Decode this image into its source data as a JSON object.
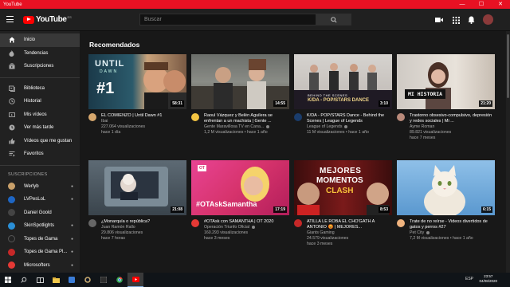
{
  "window": {
    "title": "YouTube",
    "controls": [
      "—",
      "☐",
      "✕"
    ]
  },
  "header": {
    "logo_word": "YouTube",
    "logo_country": "ES",
    "search_placeholder": "Buscar",
    "brand_color": "#ff0000"
  },
  "sidebar": {
    "main_items": [
      {
        "label": "Inicio",
        "icon": "home-icon",
        "active": true
      },
      {
        "label": "Tendencias",
        "icon": "trending-icon"
      },
      {
        "label": "Suscripciones",
        "icon": "subscriptions-icon"
      }
    ],
    "library_items": [
      {
        "label": "Biblioteca",
        "icon": "library-icon"
      },
      {
        "label": "Historial",
        "icon": "history-icon"
      },
      {
        "label": "Mis vídeos",
        "icon": "my-videos-icon"
      },
      {
        "label": "Ver más tarde",
        "icon": "watch-later-icon"
      },
      {
        "label": "Vídeos que me gustan",
        "icon": "liked-icon"
      },
      {
        "label": "Favoritos",
        "icon": "favorites-icon"
      }
    ],
    "subscriptions_header": "SUSCRIPCIONES",
    "subscriptions": [
      {
        "label": "Werlyb",
        "color": "#c9a06a"
      },
      {
        "label": "LVPesLoL",
        "color": "#1e66c4"
      },
      {
        "label": "Daniel Goold",
        "color": "#444444"
      },
      {
        "label": "SkinSpotlights",
        "color": "#2a8fd6"
      },
      {
        "label": "Topes de Gama",
        "color": "#222222"
      },
      {
        "label": "Topes de Gama Pl...",
        "color": "#c62828"
      },
      {
        "label": "Microsofters",
        "color": "#e53935"
      }
    ]
  },
  "main": {
    "section_title": "Recomendados",
    "videos": [
      {
        "title": "EL COMIENZO | Until Dawn #1",
        "channel": "Ibai",
        "views": "227.064 visualizaciones",
        "age": "hace 1 día",
        "duration": "58:31",
        "verified": true,
        "thumb": "t1",
        "avatar": "#d7a86e"
      },
      {
        "title": "Raoul Vázquez y Belén Aguilera se enfrentan a un machista | Gente ...",
        "channel": "Gente Maravillosa TV en Cana...",
        "views": "1,2 M visualizaciones",
        "age": "hace 1 año",
        "duration": "14:55",
        "verified": true,
        "thumb": "t2",
        "avatar": "#f4c542"
      },
      {
        "title": "K/DA - POP/STARS Dance - Behind the Scenes | League of Legends",
        "channel": "League of Legends",
        "views": "11 M visualizaciones",
        "age": "hace 1 año",
        "duration": "3:10",
        "verified": true,
        "thumb": "t3",
        "avatar": "#1a3c6b"
      },
      {
        "title": "Trastorno obsesivo-compulsivo, depresión y redes sociales | Mi ...",
        "channel": "Ayme Roman",
        "views": "89.821 visualizaciones",
        "age": "hace 7 meses",
        "duration": "21:20",
        "verified": false,
        "thumb": "t4",
        "avatar": "#b98a7a",
        "thumb_text": "MI HISTORIA"
      },
      {
        "title": "¿Monarquía o república?",
        "channel": "Juan Ramón Rallo",
        "views": "29.806 visualizaciones",
        "age": "hace 7 horas",
        "duration": "21:08",
        "verified": false,
        "thumb": "t5",
        "avatar": "#666666"
      },
      {
        "title": "#OTAsk con SAMANTHA | OT 2020",
        "channel": "Operación Triunfo Oficial",
        "views": "160.293 visualizaciones",
        "age": "hace 3 meses",
        "duration": "17:19",
        "verified": true,
        "thumb": "t6",
        "avatar": "#e53935",
        "thumb_text": "#OTAskSamantha"
      },
      {
        "title": "ATILLA LE ROBA EL CHO'GATH A ANTONIO 😡 | MEJORES...",
        "channel": "Giants Gaming",
        "views": "24.579 visualizaciones",
        "age": "hace 3 meses",
        "duration": "8:53",
        "verified": false,
        "thumb": "t7",
        "avatar": "#c62828",
        "thumb_text_1": "MEJORES",
        "thumb_text_2": "MOMENTOS",
        "thumb_text_3": "CLASH"
      },
      {
        "title": "Trate de no reírse - Videos divertidos de gatos y perros #27",
        "channel": "Pet City",
        "views": "7,2 M visualizaciones",
        "age": "hace 1 año",
        "duration": "6:15",
        "verified": true,
        "thumb": "t8",
        "avatar": "#f0b37e"
      }
    ]
  },
  "taskbar": {
    "time": "23:57",
    "date": "04/08/2020",
    "tray": "ESP"
  }
}
